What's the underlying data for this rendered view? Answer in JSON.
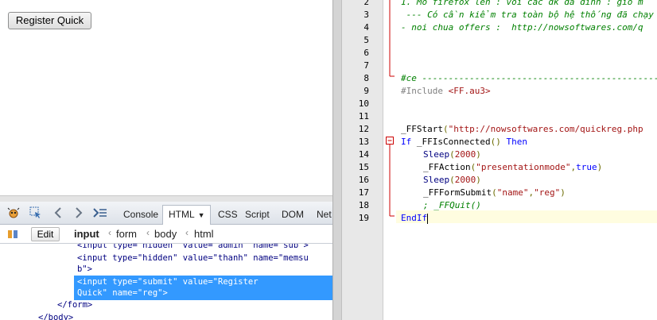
{
  "browser": {
    "register_button_label": "Register Quick"
  },
  "firebug": {
    "tabs": [
      "Console",
      "HTML",
      "CSS",
      "Script",
      "DOM",
      "Net"
    ],
    "active_tab": "HTML",
    "edit_label": "Edit",
    "breadcrumbs": [
      "input",
      "form",
      "body",
      "html"
    ],
    "tree_lines": {
      "l1": "<input type=\"hidden\" value=\"admin\" name=\"sub\">",
      "l2": "<input type=\"hidden\" value=\"thanh\" name=\"memsu",
      "l3": "b\">",
      "sel1": "<input type=\"submit\" value=\"Register",
      "sel2": "Quick\" name=\"reg\">",
      "l6": "</form>",
      "l7": "</body>"
    }
  },
  "editor": {
    "line_numbers": [
      "2",
      "3",
      "4",
      "5",
      "6",
      "7",
      "8",
      "9",
      "10",
      "11",
      "12",
      "13",
      "14",
      "15",
      "16",
      "17",
      "18",
      "19"
    ],
    "lines": {
      "l2": "1. Mo firefox len : voi cac dk da dinh : gio m",
      "l3": " --- Có cần kiểm tra toàn bộ hệ thống đã chạy",
      "l4": "- noi chua offers :  http://nowsoftwares.com/q",
      "l8": "#ce -----------------------------------------------",
      "l9_a": "#Include ",
      "l9_b": "<FF.au3>",
      "l12_a": "_FFStart",
      "l12_b": "(",
      "l12_c": "\"http://nowsoftwares.com/quickreg.php",
      "l13_a": "If ",
      "l13_b": "_FFIsConnected",
      "l13_c": "() ",
      "l13_d": "Then",
      "l14_a": "Sleep",
      "l14_b": "(",
      "l14_c": "2000",
      "l14_d": ")",
      "l15_a": "_FFAction",
      "l15_b": "(",
      "l15_c": "\"presentationmode\"",
      "l15_d": ",",
      "l15_e": "true",
      "l15_f": ")",
      "l16_a": "Sleep",
      "l16_b": "(",
      "l16_c": "2000",
      "l16_d": ")",
      "l17_a": "_FFFormSubmit",
      "l17_b": "(",
      "l17_c": "\"name\"",
      "l17_d": ",",
      "l17_e": "\"reg\"",
      "l17_f": ")",
      "l18": "; _FFQuit()",
      "l19_a": "EndIf"
    }
  },
  "colors": {
    "selection": "#3399ff",
    "comment": "#008000",
    "keyword": "#0000ff",
    "string": "#a31515",
    "fold_marker": "#cc0000"
  }
}
